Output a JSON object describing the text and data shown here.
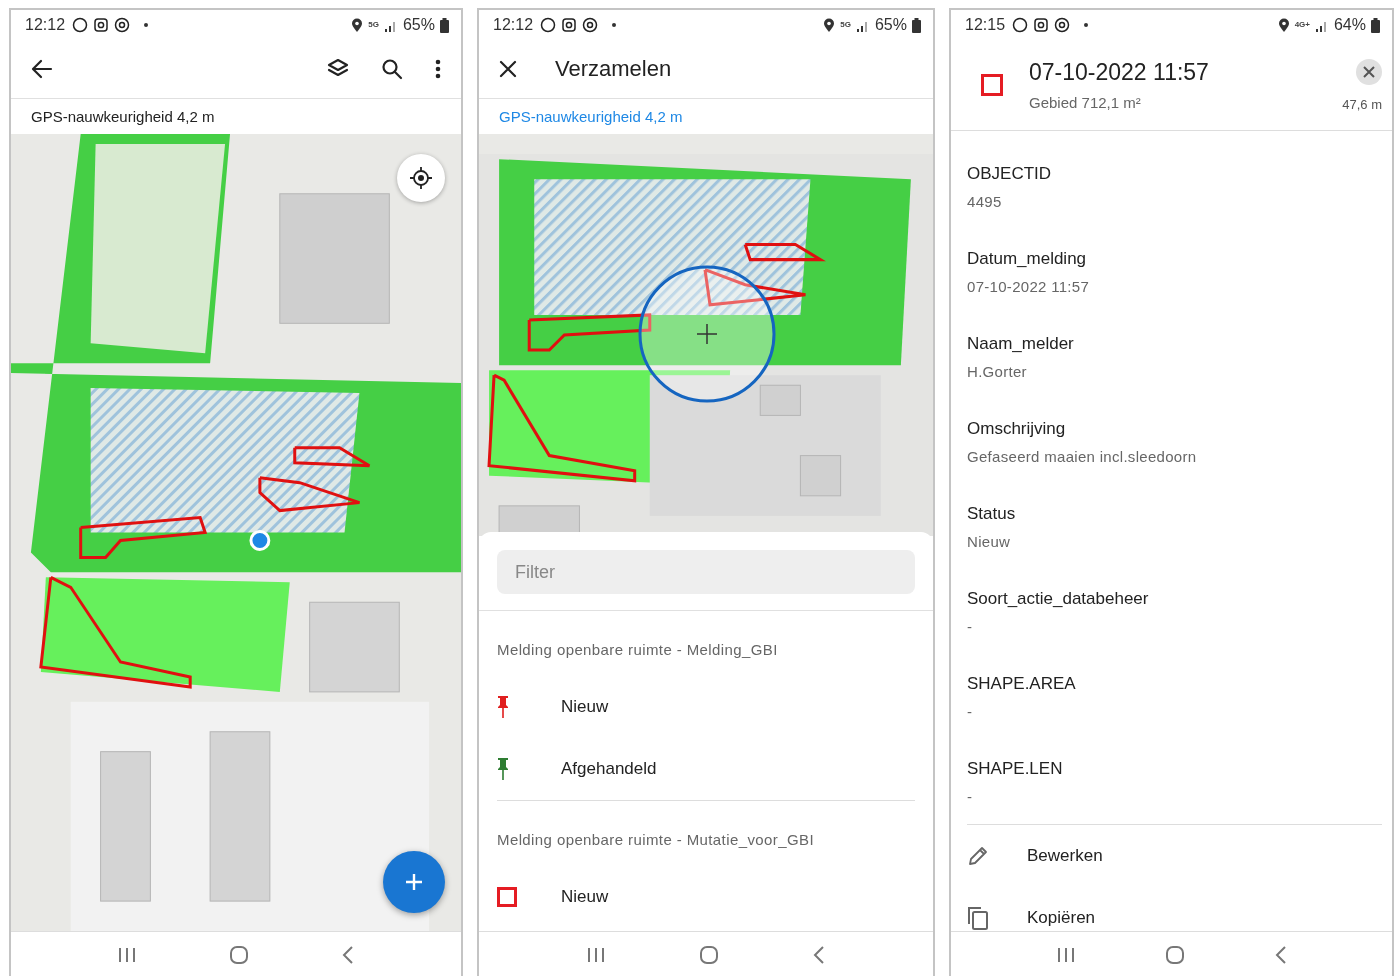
{
  "phones": [
    {
      "kind": "map_view",
      "status_bar": {
        "time": "12:12",
        "network": "5G",
        "battery": "65%"
      },
      "gps_accuracy": "GPS-nauwkeurigheid 4,2 m"
    },
    {
      "kind": "collect",
      "status_bar": {
        "time": "12:12",
        "network": "5G",
        "battery": "65%"
      },
      "title": "Verzamelen",
      "gps_accuracy": "GPS-nauwkeurigheid 4,2 m",
      "filter": {
        "placeholder": "Filter"
      },
      "groups": [
        {
          "title": "Melding openbare ruimte - Melding_GBI",
          "items": [
            {
              "label": "Nieuw",
              "kind": "pin",
              "color": "#e01f1f"
            },
            {
              "label": "Afgehandeld",
              "kind": "pin",
              "color": "#2e7d32"
            }
          ]
        },
        {
          "title": "Melding openbare ruimte - Mutatie_voor_GBI",
          "items": [
            {
              "label": "Nieuw",
              "kind": "square",
              "color": "#e51c23"
            }
          ]
        }
      ]
    },
    {
      "kind": "details",
      "status_bar": {
        "time": "12:15",
        "network": "4G+",
        "battery": "64%"
      },
      "title": "07-10-2022 11:57",
      "subtitle": "Gebied 712,1 m²",
      "distance": "47,6 m",
      "fields": [
        {
          "label": "OBJECTID",
          "value": "4495"
        },
        {
          "label": "Datum_melding",
          "value": "07-10-2022 11:57"
        },
        {
          "label": "Naam_melder",
          "value": "H.Gorter"
        },
        {
          "label": "Omschrijving",
          "value": "Gefaseerd maaien incl.sleedoorn"
        },
        {
          "label": "Status",
          "value": "Nieuw"
        },
        {
          "label": "Soort_actie_databeheer",
          "value": "-"
        },
        {
          "label": "SHAPE.AREA",
          "value": "-"
        },
        {
          "label": "SHAPE.LEN",
          "value": "-"
        }
      ],
      "actions": [
        {
          "label": "Bewerken",
          "kind": "edit"
        },
        {
          "label": "Kopiëren",
          "kind": "copy"
        }
      ]
    }
  ]
}
